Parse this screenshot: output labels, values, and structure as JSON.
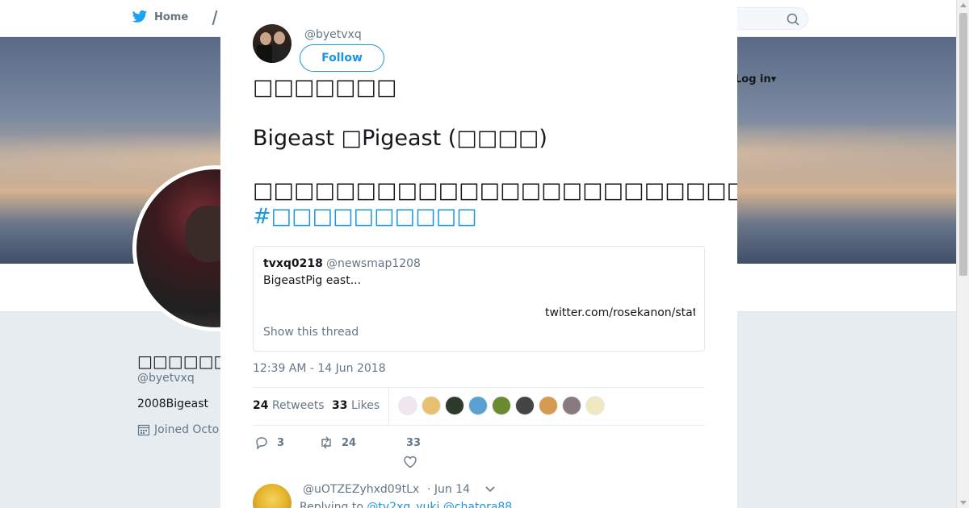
{
  "nav": {
    "home_label": "Home",
    "login_label": "Log in",
    "login_caret": "▾"
  },
  "profile": {
    "name": "□□□□□□□□",
    "handle": "@byetvxq",
    "bio": "2008Bigeast",
    "joined": "Joined Octo"
  },
  "tweet": {
    "handle": "@byetvxq",
    "follow_label": "Follow",
    "line1": "□□□□□□□",
    "line2": "Bigeast □Pigeast (□□□□)",
    "line3": "□□□□□□□□□□□□□□□□□□□□□□□□Why□□□□□□□□□□□□□□□",
    "hashtag": "#□□□□□□□□□□",
    "timestamp": "12:39 AM - 14 Jun 2018",
    "retweets_count": "24",
    "retweets_label": "Retweets",
    "likes_count": "33",
    "likes_label": "Likes",
    "reply_count": "3",
    "retweet_action_count": "24",
    "like_action_count": "33"
  },
  "quote": {
    "name": "tvxq0218",
    "handle": "@newsmap1208",
    "text": "BigeastPig east...",
    "link": "twitter.com/rosekanon/status",
    "thread_label": "Show this thread"
  },
  "likers": [
    {
      "name": "liker-1",
      "color": "#f0e6f0"
    },
    {
      "name": "liker-2",
      "color": "#e8c070"
    },
    {
      "name": "liker-3",
      "color": "#2e3b2a"
    },
    {
      "name": "liker-4",
      "color": "#5aa0d0"
    },
    {
      "name": "liker-5",
      "color": "#6a8a30"
    },
    {
      "name": "liker-6",
      "color": "#444444"
    },
    {
      "name": "liker-7",
      "color": "#d89a50"
    },
    {
      "name": "liker-8",
      "color": "#8a7a80"
    },
    {
      "name": "liker-9",
      "color": "#f0e8c0"
    }
  ],
  "reply": {
    "handle": "@uOTZEZyhxd09tLx",
    "date": "· Jun 14",
    "replying_prefix": "Replying to",
    "mention1": "@tv2xq_yuki",
    "mention2": "@chatora88"
  },
  "colors": {
    "accent": "#1b95e0",
    "muted": "#657786"
  }
}
